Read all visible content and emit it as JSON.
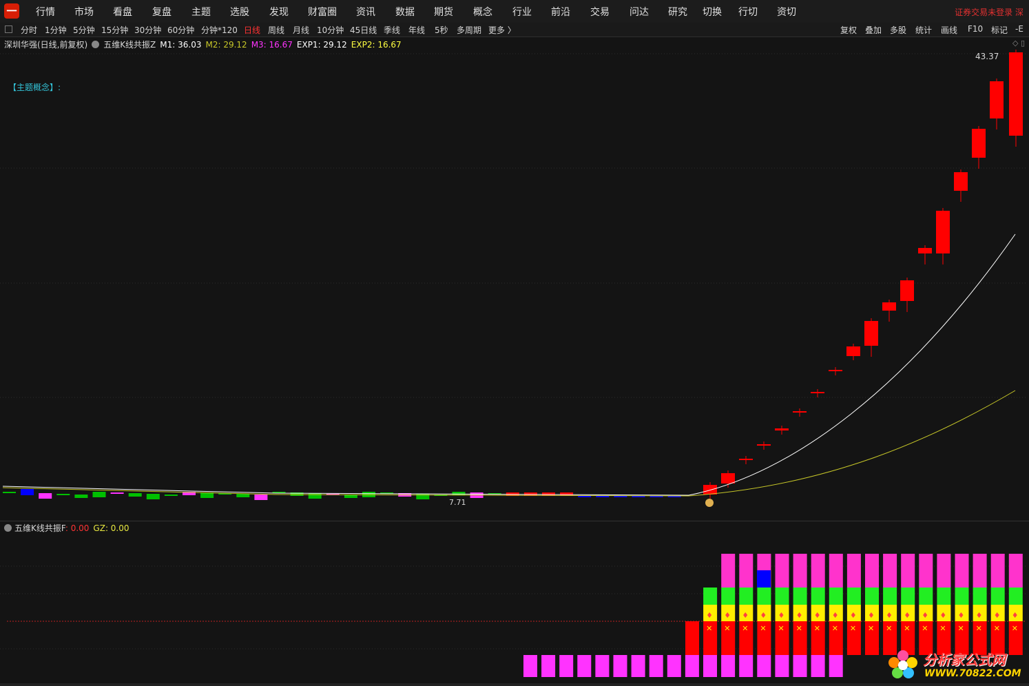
{
  "menubar": {
    "logo_glyph": "一",
    "items": [
      "行情",
      "市场",
      "看盘",
      "复盘",
      "主题",
      "选股",
      "发现",
      "财富圈",
      "资讯",
      "数据",
      "期货",
      "概念",
      "行业",
      "前沿",
      "交易",
      "问达",
      "研究",
      "切换",
      "行切",
      "资切"
    ],
    "status": "证券交易未登录  深"
  },
  "periodbar": {
    "items": [
      "分时",
      "1分钟",
      "5分钟",
      "15分钟",
      "30分钟",
      "60分钟",
      "分钟*120",
      "日线",
      "周线",
      "月线",
      "10分钟",
      "45日线",
      "季线",
      "年线",
      "5秒",
      "多周期",
      "更多 〉"
    ],
    "active": "日线",
    "tools": [
      "复权",
      "叠加",
      "多股",
      "统计",
      "画线",
      "F10",
      "标记",
      "-E"
    ]
  },
  "main_legend": {
    "stock": "深圳华强(日线,前复权)",
    "indicator": "五维K线共振Z",
    "m1": "M1: 36.03",
    "m2": "M2: 29.12",
    "m3": "M3: 16.67",
    "exp1": "EXP1: 29.12",
    "exp2": "EXP2: 16.67"
  },
  "concept_label": "【主题概念】:",
  "high_label": "43.37",
  "low_label": "7.71",
  "sub_legend": {
    "indicator": "五维K线共振F",
    "value": ": 0.00",
    "gz": "GZ: 0.00"
  },
  "watermark": {
    "title": "分析家公式网",
    "url": "WWW.70822.COM"
  },
  "colors": {
    "up": "#ff0000",
    "down": "#00c000",
    "flat": "#ff33ff",
    "blue": "#0000ff",
    "m1": "#ffffff",
    "m2": "#c8c828",
    "m3": "#ff33ff"
  }
}
